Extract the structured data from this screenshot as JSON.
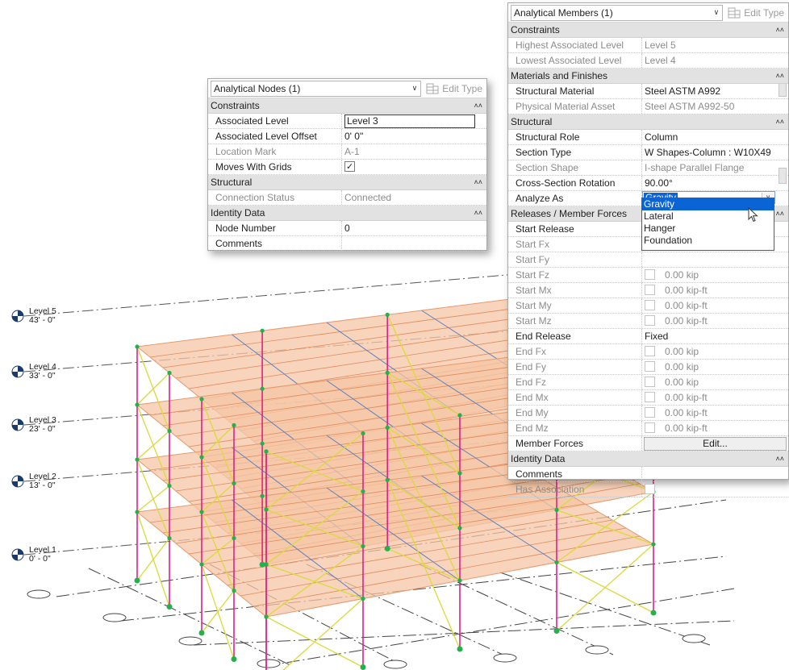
{
  "levels": [
    {
      "name": "Level 5",
      "elevation": "43' - 0\""
    },
    {
      "name": "Level 4",
      "elevation": "33' - 0\""
    },
    {
      "name": "Level 3",
      "elevation": "23' - 0\""
    },
    {
      "name": "Level 2",
      "elevation": "13' - 0\""
    },
    {
      "name": "Level 1",
      "elevation": "0' - 0\""
    }
  ],
  "nodes_panel": {
    "type_selector": "Analytical Nodes (1)",
    "edit_type": "Edit Type",
    "sections": {
      "constraints": "Constraints",
      "structural": "Structural",
      "identity": "Identity Data"
    },
    "rows": {
      "associated_level": {
        "label": "Associated Level",
        "value": "Level 3"
      },
      "associated_level_offset": {
        "label": "Associated Level Offset",
        "value": "0'  0\""
      },
      "location_mark": {
        "label": "Location Mark",
        "value": "A-1"
      },
      "moves_with_grids": {
        "label": "Moves With Grids",
        "checked": true
      },
      "connection_status": {
        "label": "Connection Status",
        "value": "Connected"
      },
      "node_number": {
        "label": "Node Number",
        "value": "0"
      },
      "comments": {
        "label": "Comments",
        "value": ""
      }
    }
  },
  "members_panel": {
    "type_selector": "Analytical Members (1)",
    "edit_type": "Edit Type",
    "sections": {
      "constraints": "Constraints",
      "materials": "Materials and Finishes",
      "structural": "Structural",
      "releases": "Releases / Member Forces",
      "identity": "Identity Data"
    },
    "rows": {
      "highest_level": {
        "label": "Highest Associated Level",
        "value": "Level 5"
      },
      "lowest_level": {
        "label": "Lowest Associated Level",
        "value": "Level 4"
      },
      "structural_material": {
        "label": "Structural Material",
        "value": "Steel ASTM A992"
      },
      "physical_material_asset": {
        "label": "Physical Material Asset",
        "value": "Steel ASTM A992-50"
      },
      "structural_role": {
        "label": "Structural Role",
        "value": "Column"
      },
      "section_type": {
        "label": "Section Type",
        "value": "W Shapes-Column : W10X49"
      },
      "section_shape": {
        "label": "Section Shape",
        "value": "I-shape Parallel Flange"
      },
      "cross_section_rotation": {
        "label": "Cross-Section Rotation",
        "value": "90.00°"
      },
      "analyze_as": {
        "label": "Analyze As",
        "value": "Gravity"
      },
      "start_release": {
        "label": "Start Release"
      },
      "start_fx": {
        "label": "Start Fx"
      },
      "start_fy": {
        "label": "Start Fy"
      },
      "start_fz": {
        "label": "Start Fz",
        "value": "0.00 kip"
      },
      "start_mx": {
        "label": "Start Mx",
        "value": "0.00 kip-ft"
      },
      "start_my": {
        "label": "Start My",
        "value": "0.00 kip-ft"
      },
      "start_mz": {
        "label": "Start Mz",
        "value": "0.00 kip-ft"
      },
      "end_release": {
        "label": "End Release",
        "value": "Fixed"
      },
      "end_fx": {
        "label": "End Fx",
        "value": "0.00 kip"
      },
      "end_fy": {
        "label": "End Fy",
        "value": "0.00 kip"
      },
      "end_fz": {
        "label": "End Fz",
        "value": "0.00 kip"
      },
      "end_mx": {
        "label": "End Mx",
        "value": "0.00 kip-ft"
      },
      "end_my": {
        "label": "End My",
        "value": "0.00 kip-ft"
      },
      "end_mz": {
        "label": "End Mz",
        "value": "0.00 kip-ft"
      },
      "member_forces": {
        "label": "Member Forces",
        "button": "Edit..."
      },
      "comments": {
        "label": "Comments",
        "value": ""
      },
      "has_association": {
        "label": "Has Association"
      }
    },
    "analyze_as_options": [
      "Gravity",
      "Lateral",
      "Hanger",
      "Foundation"
    ]
  },
  "colors": {
    "slab_fill": "#f6c6a6",
    "column": "#e0218a",
    "brace": "#dada3a",
    "beam": "#5a7fc0",
    "node": "#22b14c",
    "selection": "#0a64d6"
  }
}
